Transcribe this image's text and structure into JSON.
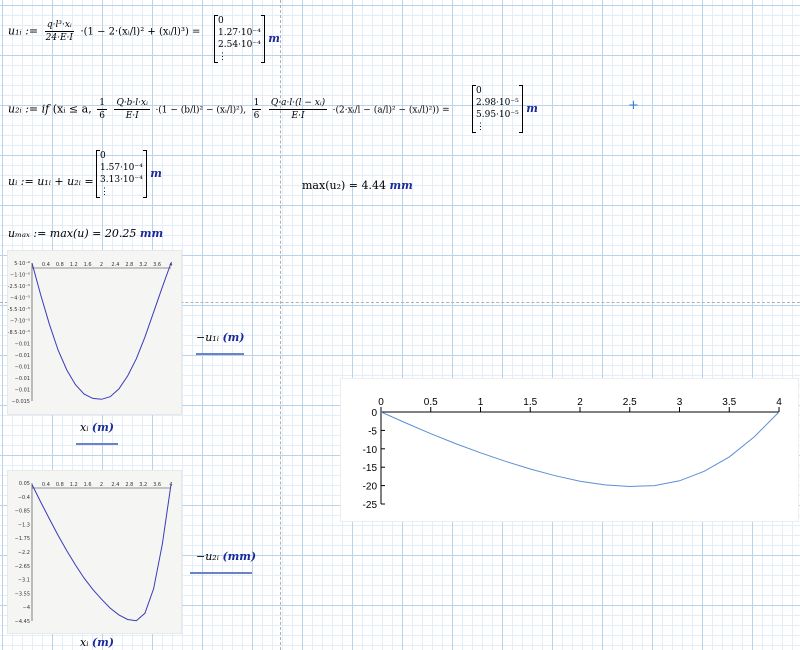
{
  "worksheet": {
    "eq1": {
      "lhs": "u₁ᵢ :=",
      "num": "q·l³·xᵢ",
      "den": "24·E·I",
      "bracket": "·(1 − 2·(xᵢ/l)² + (xᵢ/l)³) =",
      "values": [
        "0",
        "1.27·10⁻⁴",
        "2.54·10⁻⁴",
        "⋮"
      ],
      "unit": "m"
    },
    "eq2": {
      "lhs": "u₂ᵢ := if",
      "cond": "(xᵢ ≤ a,",
      "frac1_num": "1",
      "frac1_den": "6",
      "part1_num": "Q·b·l·xᵢ",
      "part1_den": "E·I",
      "part1_tail": "·(1 − (b/l)² − (xᵢ/l)²),",
      "frac2_num": "1",
      "frac2_den": "6",
      "part2_num": "Q·a·l·(l − xᵢ)",
      "part2_den": "E·I",
      "part2_tail": "·(2·xᵢ/l − (a/l)² − (xᵢ/l)²)) =",
      "values": [
        "0",
        "2.98·10⁻⁵",
        "5.95·10⁻⁵",
        "⋮"
      ],
      "unit": "m"
    },
    "eq3": {
      "lhs": "uᵢ := u₁ᵢ + u₂ᵢ =",
      "values": [
        "0",
        "1.57·10⁻⁴",
        "3.13·10⁻⁴",
        "⋮"
      ],
      "unit": "m"
    },
    "eq4": {
      "expr": "max(u₂) = 4.44",
      "unit": "mm"
    },
    "eq5": {
      "expr": "uₘₐₓ := max(u) = 20.25",
      "unit": "mm"
    },
    "plot1": {
      "ylabel": "−u₁ᵢ",
      "yunit": "(m)",
      "xlabel": "xᵢ",
      "xunit": "(m)"
    },
    "plot2": {
      "ylabel": "−u₂ᵢ",
      "yunit": "(mm)",
      "xlabel": "xᵢ",
      "xunit": "(m)"
    }
  },
  "chart_data": [
    {
      "type": "line",
      "x_ticks": [
        "0.4",
        "0.8",
        "1.2",
        "1.6",
        "2",
        "2.4",
        "2.8",
        "3.2",
        "3.6",
        "4"
      ],
      "y_ticks": [
        "5·10⁻⁶",
        "−1·10⁻⁵",
        "−2.5·10⁻⁵",
        "−4·10⁻⁵",
        "−5.5·10⁻⁵",
        "−7·10⁻⁵",
        "−8.5·10⁻⁵",
        "−0.01",
        "−0.01",
        "−0.01",
        "−0.01",
        "−0.01",
        "−0.015"
      ],
      "xlim": [
        0,
        4
      ],
      "ylim": [
        -0.016,
        5e-06
      ],
      "x": [
        0,
        0.25,
        0.5,
        0.75,
        1,
        1.25,
        1.5,
        1.75,
        2,
        2.25,
        2.5,
        2.75,
        3,
        3.25,
        3.5,
        3.75,
        4
      ],
      "values": [
        0,
        -0.0037,
        -0.0071,
        -0.0101,
        -0.0124,
        -0.0141,
        -0.0152,
        -0.0157,
        -0.0158,
        -0.0155,
        -0.0146,
        -0.0131,
        -0.0111,
        -0.0086,
        -0.0057,
        -0.0028,
        0
      ]
    },
    {
      "type": "line",
      "x_ticks": [
        "0.4",
        "0.8",
        "1.2",
        "1.6",
        "2",
        "2.4",
        "2.8",
        "3.2",
        "3.6",
        "4"
      ],
      "y_ticks": [
        "0.05",
        "−0.4",
        "−0.85",
        "−1.3",
        "−1.75",
        "−2.2",
        "−2.65",
        "−3.1",
        "−3.55",
        "−4",
        "−4.45"
      ],
      "xlim": [
        0,
        4
      ],
      "ylim": [
        -4.45,
        0.05
      ],
      "x": [
        0,
        0.25,
        0.5,
        0.75,
        1,
        1.25,
        1.5,
        1.75,
        2,
        2.25,
        2.5,
        2.75,
        3,
        3.25,
        3.5,
        3.75,
        4
      ],
      "values": [
        0,
        -0.57,
        -1.12,
        -1.66,
        -2.16,
        -2.62,
        -3.05,
        -3.42,
        -3.74,
        -4.03,
        -4.25,
        -4.4,
        -4.44,
        -4.2,
        -3.4,
        -1.95,
        0
      ]
    },
    {
      "type": "line",
      "x_ticks": [
        "0",
        "0.5",
        "1",
        "1.5",
        "2",
        "2.5",
        "3",
        "3.5",
        "4"
      ],
      "y_ticks": [
        "0",
        "-5",
        "-10",
        "-15",
        "-20",
        "-25"
      ],
      "xlim": [
        0,
        4
      ],
      "ylim": [
        -25,
        0
      ],
      "x": [
        0,
        0.25,
        0.5,
        0.75,
        1,
        1.25,
        1.5,
        1.75,
        2,
        2.25,
        2.5,
        2.75,
        3,
        3.25,
        3.5,
        3.75,
        4
      ],
      "values": [
        0,
        -3.0,
        -5.9,
        -8.6,
        -11.1,
        -13.4,
        -15.5,
        -17.3,
        -18.8,
        -19.8,
        -20.25,
        -20.0,
        -18.7,
        -16.1,
        -12.2,
        -6.8,
        0
      ]
    }
  ],
  "colors": {
    "curve": "#3a3ab8",
    "curve_light": "#5b8fd6",
    "unit": "#1a2a9a",
    "grid": "#b9d3ec"
  },
  "icons": {
    "crosshair": "crosshair-icon"
  }
}
